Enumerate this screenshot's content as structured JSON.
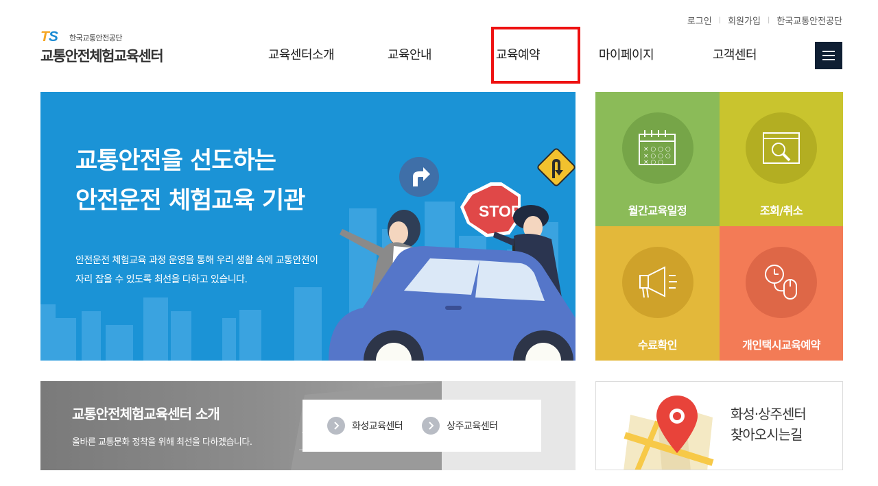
{
  "util_links": [
    "로그인",
    "회원가입",
    "한국교통안전공단"
  ],
  "logo": {
    "ts_t": "T",
    "ts_s": "S",
    "org": "한국교통안전공단",
    "site_name": "교통안전체험교육센터"
  },
  "nav": [
    "교육센터소개",
    "교육안내",
    "교육예약",
    "마이페이지",
    "고객센터"
  ],
  "hero": {
    "title_lines": [
      "교통안전을 선도하는",
      "안전운전 체험교육 기관"
    ],
    "desc_lines": [
      "안전운전 체험교육 과정 운영을 통해 우리 생활 속에 교통안전이",
      "자리 잡을 수 있도록 최선을 다하고 있습니다."
    ],
    "stop_sign": "STOP"
  },
  "tiles": [
    {
      "label": "월간교육일정",
      "icon": "calendar-icon",
      "color": "#8bbb58"
    },
    {
      "label": "조회/취소",
      "icon": "search-window-icon",
      "color": "#c9c42e"
    },
    {
      "label": "수료확인",
      "icon": "megaphone-icon",
      "color": "#e3b83a"
    },
    {
      "label": "개인택시교육예약",
      "icon": "clock-mouse-icon",
      "color": "#f37b56"
    }
  ],
  "intro": {
    "title": "교통안전체험교육센터 소개",
    "desc": "올바른 교통문화 정착을 위해 최선을 다하겠습니다.",
    "links": [
      "화성교육센터",
      "상주교육센터"
    ]
  },
  "map": {
    "lines": [
      "화성·상주센터",
      "찾아오시는길"
    ]
  },
  "colors": {
    "hero_bg": "#1b93d6",
    "nav_highlight": "#ee1111",
    "hamburger_bg": "#0f1f33"
  }
}
